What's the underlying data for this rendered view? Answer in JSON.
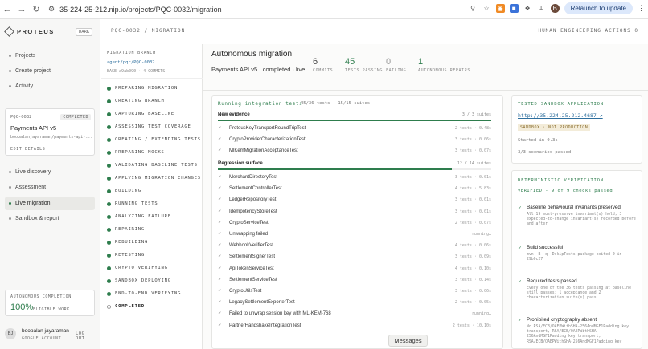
{
  "browser": {
    "url": "35-224-25-212.nip.io/projects/PQC-0032/migration",
    "relaunch_label": "Relaunch to update",
    "profile_initial": "B"
  },
  "sidebar": {
    "logo": "PROTEUS",
    "dark_toggle": "DARK",
    "nav_top": [
      {
        "label": "Projects"
      },
      {
        "label": "Create project"
      },
      {
        "label": "Activity"
      }
    ],
    "project": {
      "code": "PQC-0032",
      "status": "COMPLETED",
      "name": "Payments API v5",
      "path": "boopalanjayaraman/payments-api-...",
      "edit": "EDIT DETAILS"
    },
    "nav_project": [
      {
        "label": "Live discovery"
      },
      {
        "label": "Assessment"
      },
      {
        "label": "Live migration"
      },
      {
        "label": "Sandbox & report"
      }
    ],
    "autonomous": {
      "label": "AUTONOMOUS COMPLETION",
      "percent": "100%",
      "sub": "ELIGIBLE WORK"
    },
    "user": {
      "initials": "BJ",
      "name": "boopalan jayaraman",
      "account": "GOOGLE ACCOUNT",
      "logout": "LOG OUT"
    }
  },
  "header": {
    "breadcrumb": "PQC-0032 / MIGRATION",
    "actions": "HUMAN ENGINEERING ACTIONS 0"
  },
  "steps": {
    "branch_label": "MIGRATION BRANCH",
    "branch": "agent/pqc/PQC-0032",
    "base": "BASE a9ab090 · 4 COMMITS",
    "items": [
      "PREPARING MIGRATION",
      "CREATING BRANCH",
      "CAPTURING BASELINE",
      "ASSESSING TEST COVERAGE",
      "CREATING / EXTENDING TESTS",
      "PREPARING MOCKS",
      "VALIDATING BASELINE TESTS",
      "APPLYING MIGRATION CHANGES",
      "BUILDING",
      "RUNNING TESTS",
      "ANALYZING FAILURE",
      "REPAIRING",
      "REBUILDING",
      "RETESTING",
      "CRYPTO VERIFYING",
      "SANDBOX DEPLOYING",
      "END-TO-END VERIFYING",
      "COMPLETED"
    ]
  },
  "main": {
    "title": "Autonomous migration",
    "subtitle": "Payments API v5 · completed · live",
    "stats": [
      {
        "value": "6",
        "label": "COMMITS"
      },
      {
        "value": "45",
        "label": "TESTS PASSING"
      },
      {
        "value": "0",
        "label": "FAILING"
      },
      {
        "value": "1",
        "label": "AUTONOMOUS REPAIRS"
      }
    ],
    "tests": {
      "heading": "Running integration tests",
      "count": "45/36 tests · 15/15 suites",
      "groups": [
        {
          "name": "New evidence",
          "count": "3 / 3 suites",
          "fill": 1.0,
          "rows": [
            {
              "name": "ProteusKeyTransportRoundTripTest",
              "meta": "2 tests · 0.48s"
            },
            {
              "name": "CryptoProviderCharacterizationTest",
              "meta": "3 tests · 0.06s"
            },
            {
              "name": "MlKemMigrationAcceptanceTest",
              "meta": "3 tests · 0.07s"
            }
          ]
        },
        {
          "name": "Regression surface",
          "count": "12 / 14 suites",
          "fill": 0.857,
          "rows": [
            {
              "name": "MerchantDirectoryTest",
              "meta": "3 tests · 0.01s"
            },
            {
              "name": "SettlementControllerTest",
              "meta": "4 tests · 5.83s"
            },
            {
              "name": "LedgerRepositoryTest",
              "meta": "3 tests · 0.01s"
            },
            {
              "name": "IdempotencyStoreTest",
              "meta": "3 tests · 0.01s"
            },
            {
              "name": "CryptoServiceTest",
              "meta": "2 tests · 0.07s"
            },
            {
              "name": "Unwrapping failed",
              "meta": "running…"
            },
            {
              "name": "WebhookVerifierTest",
              "meta": "4 tests · 0.06s"
            },
            {
              "name": "SettlementSignerTest",
              "meta": "3 tests · 0.09s"
            },
            {
              "name": "ApiTokenServiceTest",
              "meta": "4 tests · 0.10s"
            },
            {
              "name": "SettlementServiceTest",
              "meta": "3 tests · 0.14s"
            },
            {
              "name": "CryptoUtilsTest",
              "meta": "3 tests · 0.06s"
            },
            {
              "name": "LegacySettlementExporterTest",
              "meta": "2 tests · 0.05s"
            },
            {
              "name": "Failed to unwrap session key with ML-KEM-768",
              "meta": "running…"
            },
            {
              "name": "PartnerHandshakeIntegrationTest",
              "meta": "2 tests · 10.10s"
            }
          ]
        }
      ]
    },
    "sandbox": {
      "label": "TESTED SANDBOX APPLICATION",
      "url": "http://35.224.25.212.4687 ↗",
      "badge": "SANDBOX · NOT PRODUCTION",
      "started": "Started in 0.3s",
      "scenarios": "3/3 scenarios passed"
    },
    "verification": {
      "label": "DETERMINISTIC VERIFICATION",
      "status": "VERIFIED - 9 of 9 checks passed",
      "items": [
        {
          "title": "Baseline behavioural invariants preserved",
          "desc": "All 19 must-preserve invariant(s) hold; 3 expected-to-change invariant(s) recorded before and after"
        },
        {
          "title": "Build successful",
          "desc": "mvn -B -q -DskipTests package exited 0 in 29b0c27"
        },
        {
          "title": "Required tests passed",
          "desc": "Every one of the 36 tests passing at baseline still passes; 1 acceptance and 2 characterization suite(s) pass"
        },
        {
          "title": "Prohibited cryptography absent",
          "desc": "No RSA/ECB/OAEPWithSHA-256AndMGF1Padding key transport, RSA/ECB/OAEPWithSHA-256AndMGF1Padding key transport, RSA/ECB/OAEPWithSHA-256AndMGF1Padding key"
        }
      ]
    }
  },
  "messages_label": "Messages"
}
